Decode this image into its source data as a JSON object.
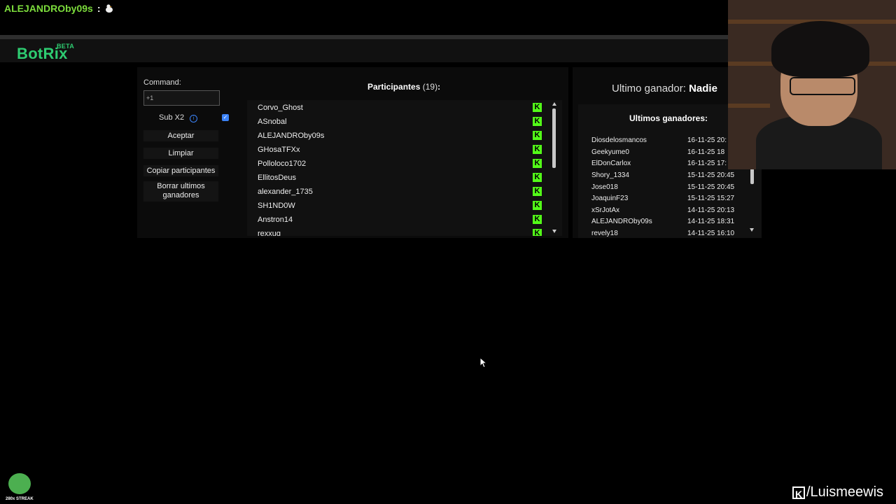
{
  "chat": {
    "username": "ALEJANDROby09s",
    "separator": ":"
  },
  "app": {
    "logo": "BotRix",
    "logo_badge": "BETA"
  },
  "controls": {
    "command_label": "Command:",
    "command_value": "+1",
    "sub_label": "Sub X2",
    "sub_checked": true,
    "accept_label": "Aceptar",
    "clear_label": "Limpiar",
    "copy_label": "Copiar participantes",
    "delete_label": "Borrar ultimos ganadores"
  },
  "participants": {
    "title": "Participantes",
    "count": "(19)",
    "colon": ":",
    "items": [
      "Corvo_Ghost",
      "ASnobal",
      "ALEJANDROby09s",
      "GHosaTFXx",
      "Polloloco1702",
      "EllitosDeus",
      "alexander_1735",
      "SH1ND0W",
      "Anstron14",
      "rexxug"
    ]
  },
  "winner": {
    "label": "Ultimo ganador:",
    "name": "Nadie"
  },
  "last_winners": {
    "title": "Ultimos ganadores:",
    "rows": [
      {
        "name": "Diosdelosmancos",
        "date": "16-11-25 20:"
      },
      {
        "name": "Geekyume0",
        "date": "16-11-25 18"
      },
      {
        "name": "ElDonCarlox",
        "date": "16-11-25 17:"
      },
      {
        "name": "Shory_1334",
        "date": "15-11-25 20:45"
      },
      {
        "name": "Jose018",
        "date": "15-11-25 20:45"
      },
      {
        "name": "JoaquinF23",
        "date": "15-11-25 15:27"
      },
      {
        "name": "xSrJotAx",
        "date": "14-11-25 20:13"
      },
      {
        "name": "ALEJANDROby09s",
        "date": "14-11-25 18:31"
      },
      {
        "name": "revely18",
        "date": "14-11-25 16:10"
      }
    ]
  },
  "overlay": {
    "streak_label": "280x STREAK",
    "channel": "/Luismeewis"
  },
  "colors": {
    "accent_green": "#2ecc71",
    "kick_green": "#53fc18",
    "checkbox_blue": "#3b82f6"
  }
}
